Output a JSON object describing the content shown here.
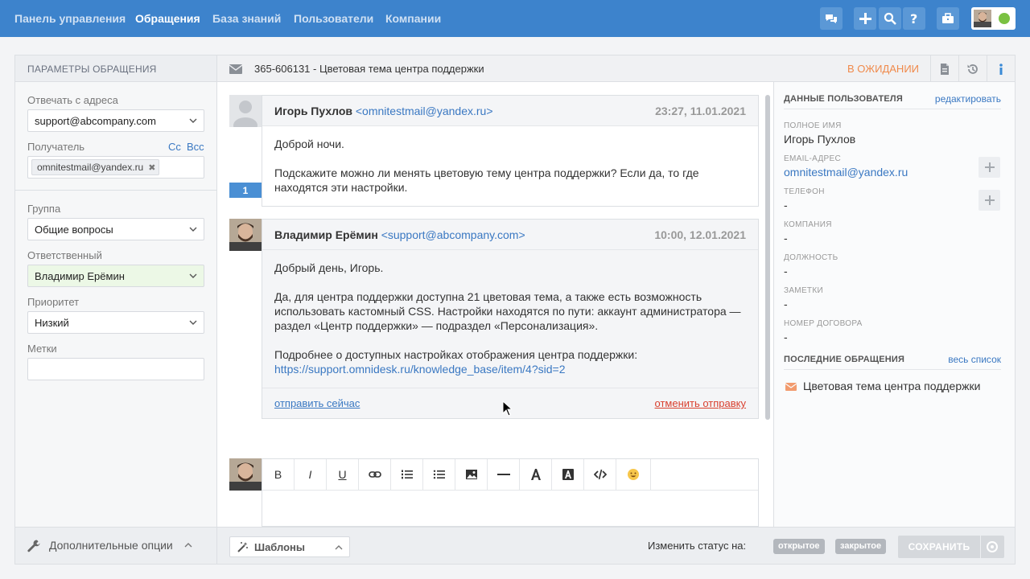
{
  "topnav": {
    "items": [
      "Панель управления",
      "Обращения",
      "База знаний",
      "Пользователи",
      "Компании"
    ],
    "active_index": 1,
    "icons": [
      "chat-icon",
      "plus-icon",
      "search-icon",
      "help-icon",
      "briefcase-icon"
    ]
  },
  "left_panel": {
    "header": "ПАРАМЕТРЫ ОБРАЩЕНИЯ",
    "reply_from_label": "Отвечать с адреса",
    "reply_from_value": "support@abcompany.com",
    "recipient_label": "Получатель",
    "cc_label": "Cc",
    "bcc_label": "Bcc",
    "recipient_tag": "omnitestmail@yandex.ru",
    "group_label": "Группа",
    "group_value": "Общие вопросы",
    "assignee_label": "Ответственный",
    "assignee_value": "Владимир Ерёмин",
    "priority_label": "Приоритет",
    "priority_value": "Низкий",
    "tags_label": "Метки",
    "tags_value": "",
    "extra_options": "Дополнительные опции"
  },
  "ticket": {
    "subject": "365-606131 - Цветовая тема центра поддержки",
    "status": "В ОЖИДАНИИ"
  },
  "messages": [
    {
      "author": "Игорь Пухлов",
      "email": "<omnitestmail@yandex.ru>",
      "time": "23:27, 11.01.2021",
      "badge": "1",
      "paragraphs": [
        "Доброй ночи.",
        "Подскажите можно ли менять цветовую тему центра поддержки? Если да, то где находятся эти настройки."
      ]
    },
    {
      "author": "Владимир Ерёмин",
      "email": "<support@abcompany.com>",
      "time": "10:00, 12.01.2021",
      "paragraphs": [
        "Добрый день, Игорь.",
        "Да, для центра поддержки доступна 21 цветовая тема, а также есть возможность использовать кастомный CSS. Настройки находятся по пути: аккаунт администратора — раздел «Центр поддержки» — подраздел «Персонализация».",
        "Подробнее о доступных настройках отображения центра поддержки:"
      ],
      "link": "https://support.omnidesk.ru/knowledge_base/item/4?sid=2",
      "send_now": "отправить сейчас",
      "cancel_send": "отменить отправку"
    }
  ],
  "editor": {
    "tools": [
      "B",
      "I",
      "U",
      "link-icon",
      "ordered-list-icon",
      "bullet-list-icon",
      "image-icon",
      "hr-icon",
      "font-icon",
      "font-bg-icon",
      "code-icon",
      "emoji-icon"
    ]
  },
  "bottom_bar": {
    "templates": "Шаблоны",
    "change_status": "Изменить статус на:",
    "status_open": "открытое",
    "status_closed": "закрытое",
    "save": "СОХРАНИТЬ"
  },
  "user_panel": {
    "header": "ДАННЫЕ ПОЛЬЗОВАТЕЛЯ",
    "edit": "редактировать",
    "full_name_label": "ПОЛНОЕ ИМЯ",
    "full_name": "Игорь Пухлов",
    "email_label": "EMAIL-АДРЕС",
    "email": "omnitestmail@yandex.ru",
    "phone_label": "ТЕЛЕФОН",
    "phone": "-",
    "company_label": "КОМПАНИЯ",
    "company": "-",
    "position_label": "ДОЛЖНОСТЬ",
    "position": "-",
    "notes_label": "ЗАМЕТКИ",
    "notes": "-",
    "contract_label": "НОМЕР ДОГОВОРА",
    "contract": "-",
    "recent_header": "ПОСЛЕДНИЕ ОБРАЩЕНИЯ",
    "recent_all": "весь список",
    "recent_items": [
      "Цветовая тема центра поддержки"
    ]
  },
  "colors": {
    "brand": "#3d83cc",
    "status_pending": "#f08a4b",
    "online": "#7ac142",
    "cancel": "#d9412f"
  }
}
